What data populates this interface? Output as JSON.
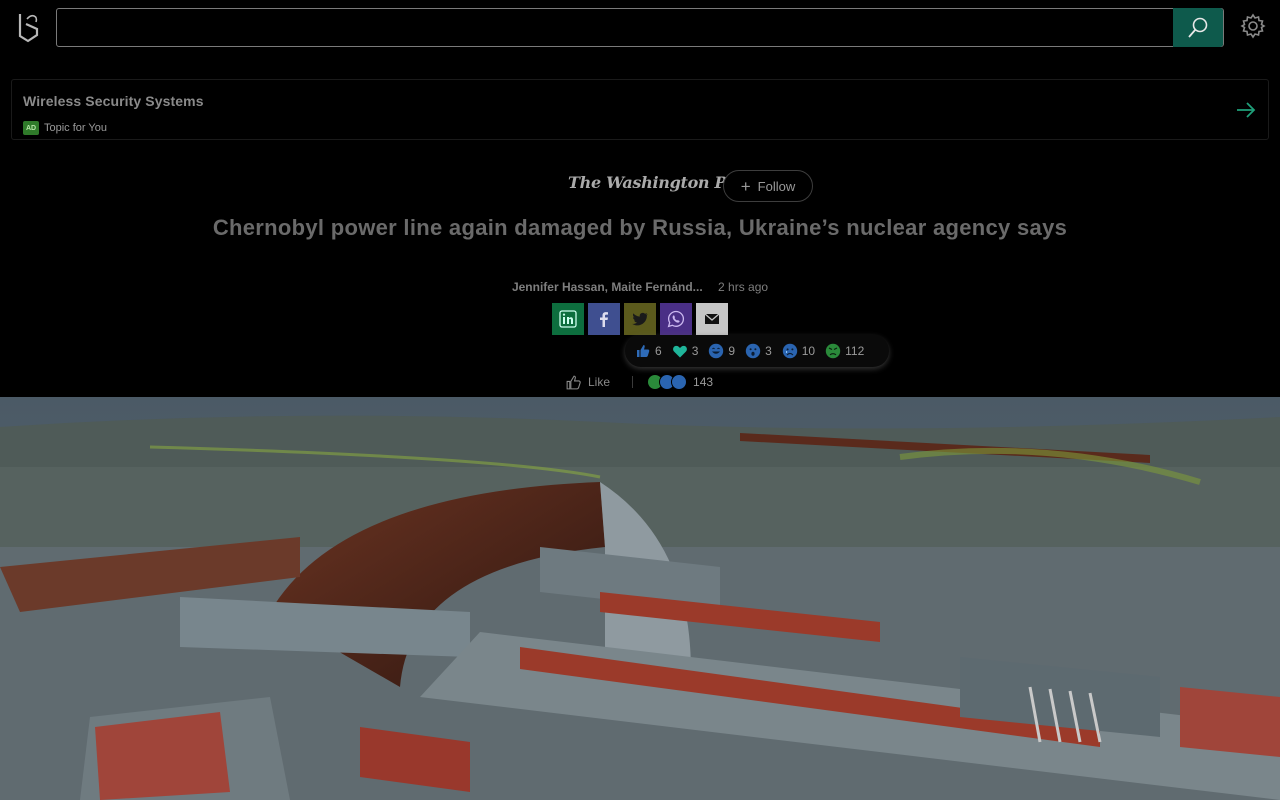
{
  "search": {
    "value": "",
    "placeholder": ""
  },
  "icons": {
    "logo": "bing-logo-icon",
    "search": "search-icon",
    "settings": "gear-icon",
    "arrow": "arrow-right-icon"
  },
  "topic_card": {
    "title": "Wireless Security Systems",
    "badge": "AD",
    "subtitle": "Topic for You"
  },
  "article": {
    "publisher": "The Washington Post",
    "follow_label": "Follow",
    "headline": "Chernobyl power line again damaged by Russia, Ukraine’s nuclear agency says",
    "authors": "Jennifer Hassan, Maite Fernánd...",
    "time_ago": "2 hrs ago"
  },
  "share": [
    "linkedin",
    "facebook",
    "twitter",
    "whatsapp",
    "email"
  ],
  "reactions": [
    {
      "name": "like",
      "count": "6",
      "color": "#2e6bb8"
    },
    {
      "name": "heart",
      "count": "3",
      "color": "#1fb59a"
    },
    {
      "name": "laugh",
      "count": "9",
      "color": "#2a64b0"
    },
    {
      "name": "surprised",
      "count": "3",
      "color": "#2a64b0"
    },
    {
      "name": "sad",
      "count": "10",
      "color": "#2a64b0"
    },
    {
      "name": "angry",
      "count": "112",
      "color": "#2a8a3a"
    }
  ],
  "like_row": {
    "label": "Like",
    "total": "143"
  },
  "colors": {
    "accent": "#0e5a4c",
    "background": "#000000"
  }
}
